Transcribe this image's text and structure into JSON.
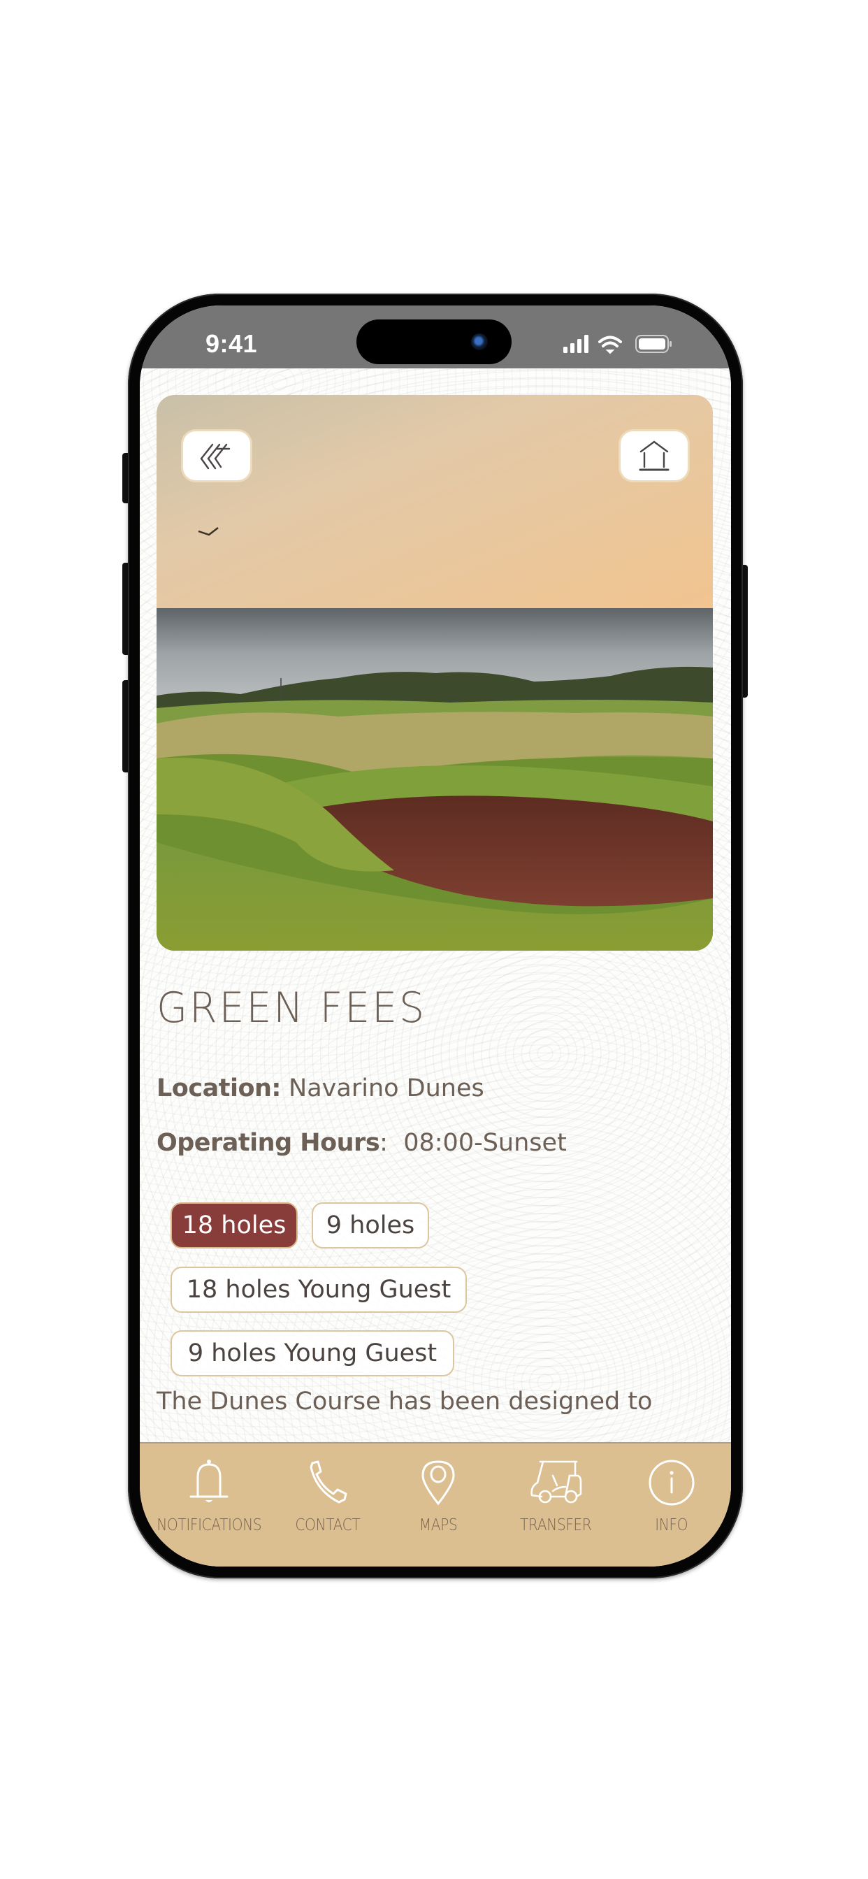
{
  "status_bar": {
    "time": "9:41",
    "icons": [
      "cellular-signal-icon",
      "wifi-icon",
      "battery-icon"
    ]
  },
  "header": {
    "back_button_icon": "triple-chevron-left-icon",
    "home_button_icon": "home-icon"
  },
  "page": {
    "title": "GREEN FEES",
    "location_label": "Location:",
    "location_value": "Navarino Dunes",
    "hours_label": "Operating Hours",
    "hours_separator": ":",
    "hours_value": "08:00-Sunset",
    "options": [
      {
        "label": "18 holes",
        "selected": true
      },
      {
        "label": "9 holes",
        "selected": false
      },
      {
        "label": "18 holes Young Guest",
        "selected": false
      },
      {
        "label": "9 holes Young Guest",
        "selected": false
      }
    ],
    "description": "The Dunes Course has been designed to"
  },
  "tab_bar": {
    "items": [
      {
        "label": "NOTIFICATIONS",
        "icon": "bell-icon"
      },
      {
        "label": "CONTACT",
        "icon": "phone-icon"
      },
      {
        "label": "MAPS",
        "icon": "map-pin-icon"
      },
      {
        "label": "TRANSFER",
        "icon": "golf-cart-icon"
      },
      {
        "label": "INFO",
        "icon": "info-icon"
      }
    ]
  },
  "colors": {
    "accent_selected": "#893d3b",
    "chip_border": "#dcc69f",
    "tab_bar_bg": "#dbbf91",
    "text_primary": "#6c5f55",
    "status_bar_bg": "#767676"
  }
}
